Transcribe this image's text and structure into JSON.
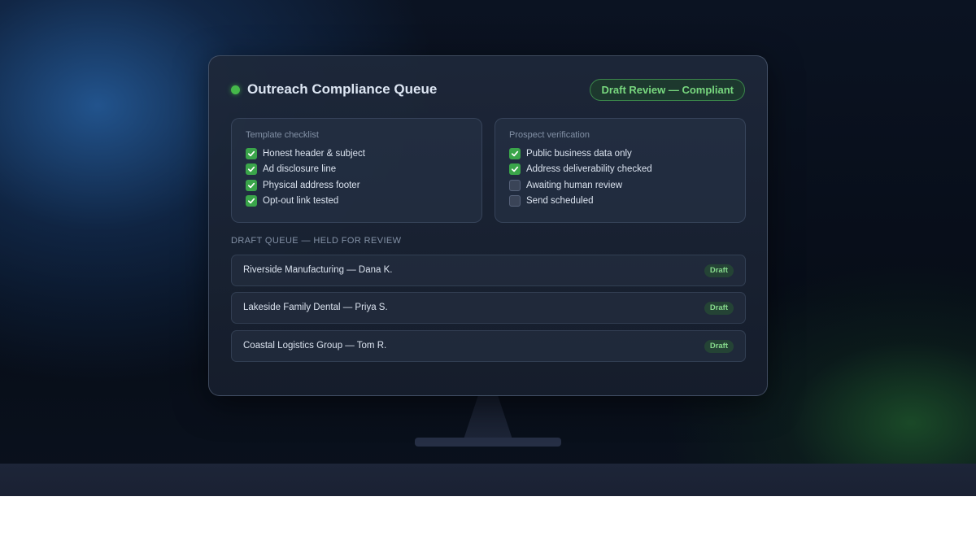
{
  "header": {
    "title": "Outreach Compliance Queue",
    "status_pill": "Draft Review — Compliant"
  },
  "template_checklist": {
    "title": "Template checklist",
    "items": [
      {
        "label": "Honest header & subject",
        "checked": true
      },
      {
        "label": "Ad disclosure line",
        "checked": true
      },
      {
        "label": "Physical address footer",
        "checked": true
      },
      {
        "label": "Opt-out link tested",
        "checked": true
      }
    ]
  },
  "prospect_verification": {
    "title": "Prospect verification",
    "items": [
      {
        "label": "Public business data only",
        "checked": true
      },
      {
        "label": "Address deliverability checked",
        "checked": true
      },
      {
        "label": "Awaiting human review",
        "checked": false
      },
      {
        "label": "Send scheduled",
        "checked": false
      }
    ]
  },
  "queue": {
    "section_label": "DRAFT QUEUE — HELD FOR REVIEW",
    "rows": [
      {
        "name": "Riverside Manufacturing — Dana K.",
        "status": "Draft"
      },
      {
        "name": "Lakeside Family Dental — Priya S.",
        "status": "Draft"
      },
      {
        "name": "Coastal Logistics Group — Tom R.",
        "status": "Draft"
      }
    ]
  },
  "colors": {
    "accent_green": "#45b84a",
    "unchecked": "#3a4457"
  },
  "icons": {
    "status": "status-dot-icon",
    "check": "checkmark-icon"
  }
}
